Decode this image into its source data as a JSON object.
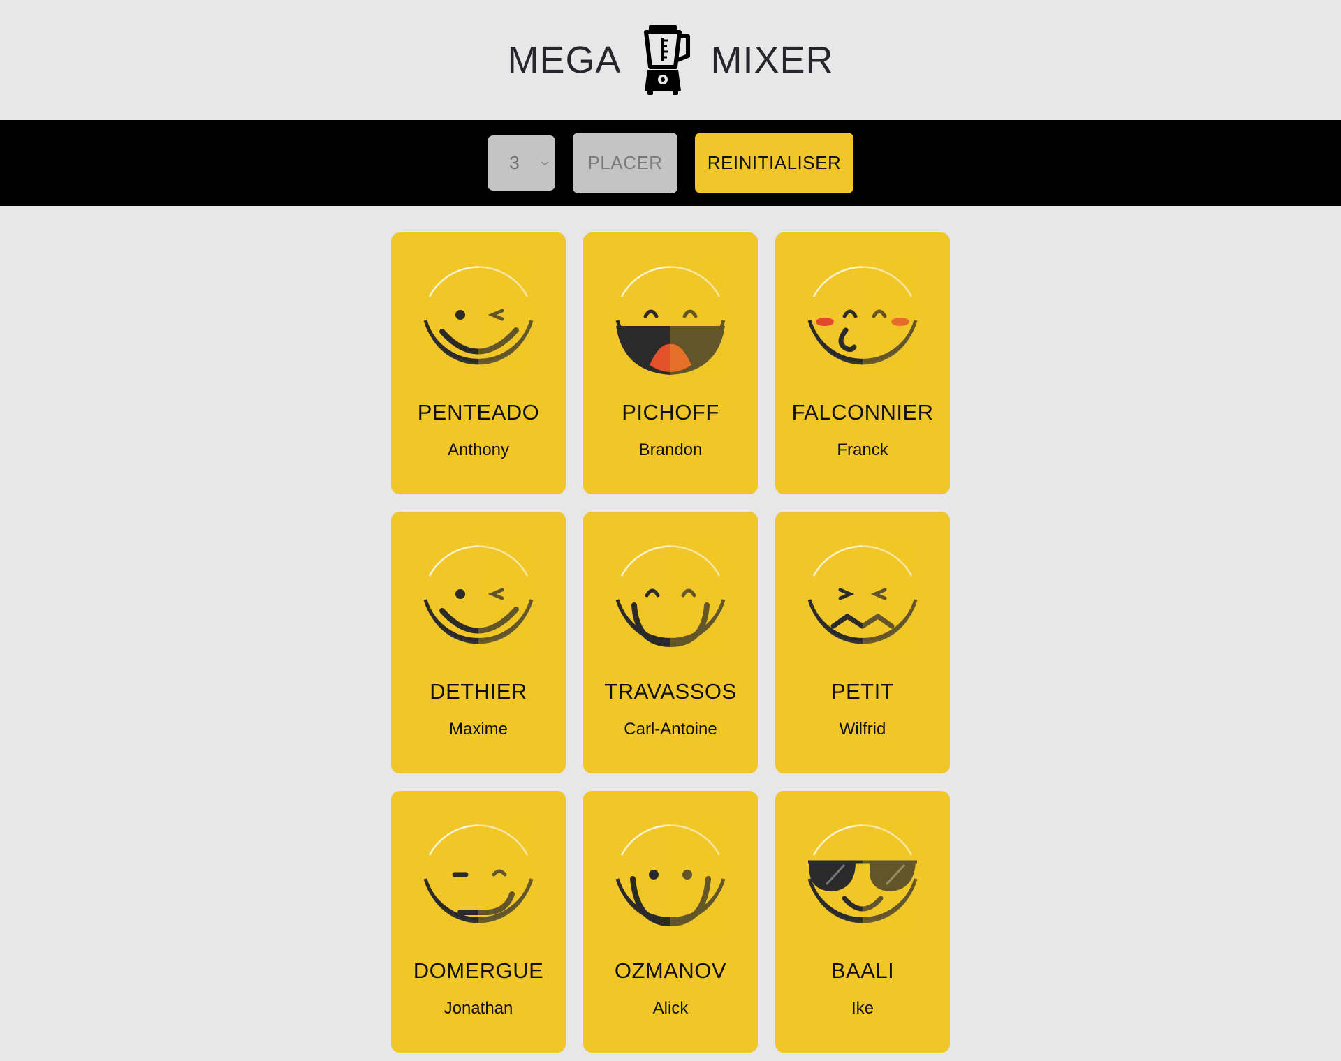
{
  "header": {
    "title_left": "MEGA",
    "title_right": "MIXER",
    "logo_icon": "blender-icon"
  },
  "toolbar": {
    "group_size_value": "3",
    "place_label": "PLACER",
    "reset_label": "REINITIALISER"
  },
  "colors": {
    "background": "#e8e7e8",
    "toolbar": "#000000",
    "accent": "#f1c62a",
    "disabled": "#c4c4c4"
  },
  "cards": [
    {
      "last": "PENTEADO",
      "first": "Anthony",
      "icon": "winking-face-icon"
    },
    {
      "last": "PICHOFF",
      "first": "Brandon",
      "icon": "laughing-face-icon"
    },
    {
      "last": "FALCONNIER",
      "first": "Franck",
      "icon": "blushing-face-icon"
    },
    {
      "last": "DETHIER",
      "first": "Maxime",
      "icon": "winking-face-icon"
    },
    {
      "last": "TRAVASSOS",
      "first": "Carl-Antoine",
      "icon": "happy-face-icon"
    },
    {
      "last": "PETIT",
      "first": "Wilfrid",
      "icon": "confounded-face-icon"
    },
    {
      "last": "DOMERGUE",
      "first": "Jonathan",
      "icon": "smirking-face-icon"
    },
    {
      "last": "OZMANOV",
      "first": "Alick",
      "icon": "smiling-face-icon"
    },
    {
      "last": "BAALI",
      "first": "Ike",
      "icon": "sunglasses-face-icon"
    }
  ]
}
